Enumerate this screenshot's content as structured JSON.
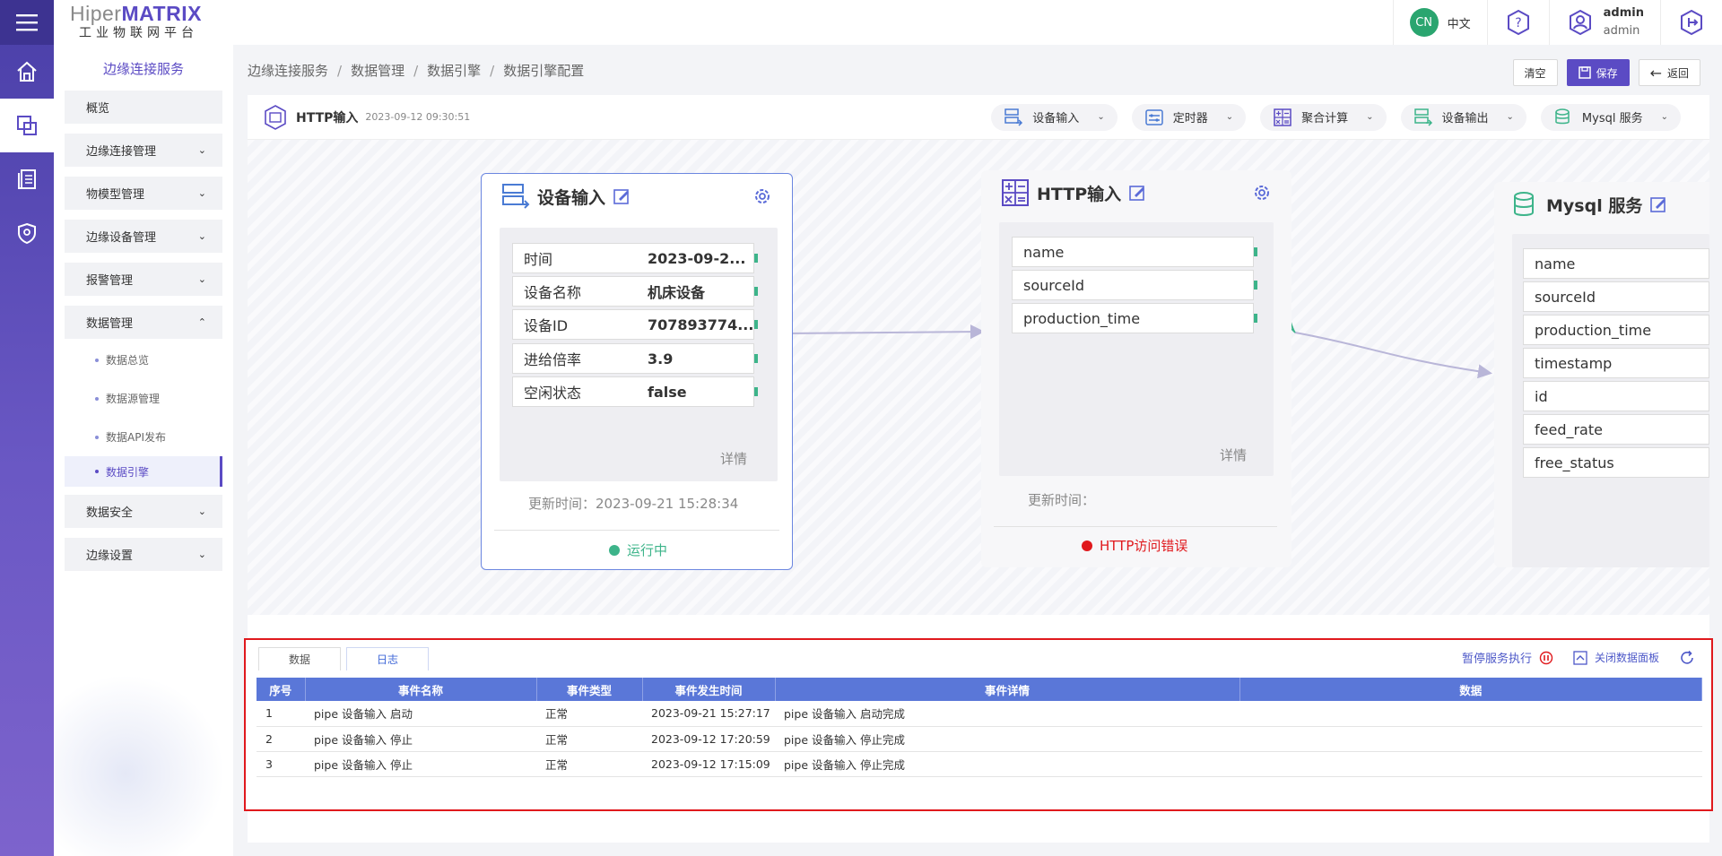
{
  "brand": {
    "name_gray": "Hiper",
    "name_bold": "MATRIX",
    "subtitle": "工业物联网平台"
  },
  "sidebar": {
    "title": "边缘连接服务",
    "items": [
      {
        "label": "概览"
      },
      {
        "label": "边缘连接管理"
      },
      {
        "label": "物模型管理"
      },
      {
        "label": "边缘设备管理"
      },
      {
        "label": "报警管理"
      },
      {
        "label": "数据管理"
      }
    ],
    "sub_items": [
      {
        "label": "数据总览"
      },
      {
        "label": "数据源管理"
      },
      {
        "label": "数据API发布"
      },
      {
        "label": "数据引擎"
      }
    ],
    "items_after": [
      {
        "label": "数据安全"
      },
      {
        "label": "边缘设置"
      }
    ]
  },
  "topbar": {
    "lang_badge": "CN",
    "lang_label": "中文",
    "user_name": "admin",
    "user_role": "admin"
  },
  "breadcrumb": [
    "边缘连接服务",
    "数据管理",
    "数据引擎",
    "数据引擎配置"
  ],
  "actions": {
    "clear": "清空",
    "save": "保存",
    "back": "返回"
  },
  "toolbar": {
    "title": "HTTP输入",
    "time": "2023-09-12 09:30:51",
    "pills": [
      {
        "label": "设备输入",
        "icon": "device-input-icon"
      },
      {
        "label": "定时器",
        "icon": "timer-icon"
      },
      {
        "label": "聚合计算",
        "icon": "calculator-icon"
      },
      {
        "label": "设备输出",
        "icon": "device-output-icon"
      },
      {
        "label": "Mysql 服务",
        "icon": "database-icon"
      }
    ]
  },
  "nodes": {
    "device_input": {
      "title": "设备输入",
      "fields": [
        {
          "name": "时间",
          "value": "2023-09-2..."
        },
        {
          "name": "设备名称",
          "value": "机床设备"
        },
        {
          "name": "设备ID",
          "value": "707893774..."
        },
        {
          "name": "进给倍率",
          "value": "3.9"
        },
        {
          "name": "空闲状态",
          "value": "false"
        }
      ],
      "detail": "详情",
      "updated": "更新时间：2023-09-21 15:28:34",
      "status": "运行中",
      "status_color": "#3db48a"
    },
    "http_input": {
      "title": "HTTP输入",
      "fields": [
        "name",
        "sourceId",
        "production_time"
      ],
      "detail": "详情",
      "updated": "更新时间：",
      "status": "HTTP访问错误",
      "status_color": "#e0191d"
    },
    "mysql": {
      "title": "Mysql 服务",
      "fields": [
        "name",
        "sourceId",
        "production_time",
        "timestamp",
        "id",
        "feed_rate",
        "free_status"
      ]
    }
  },
  "log": {
    "tabs": [
      "数据",
      "日志"
    ],
    "active_tab": "日志",
    "pause": "暂停服务执行",
    "close": "关闭数据面板",
    "columns": [
      "序号",
      "事件名称",
      "事件类型",
      "事件发生时间",
      "事件详情",
      "数据"
    ],
    "rows": [
      [
        "1",
        "pipe 设备输入 启动",
        "正常",
        "2023-09-21 15:27:17",
        "pipe 设备输入 启动完成",
        ""
      ],
      [
        "2",
        "pipe 设备输入 停止",
        "正常",
        "2023-09-12 17:20:59",
        "pipe 设备输入 停止完成",
        ""
      ],
      [
        "3",
        "pipe 设备输入 停止",
        "正常",
        "2023-09-12 17:15:09",
        "pipe 设备输入 停止完成",
        ""
      ]
    ]
  },
  "colors": {
    "accent": "#5b4bc4",
    "table_header": "#5a77d8",
    "link_curve": "#3db48a",
    "edge": "#b9b6d8"
  }
}
